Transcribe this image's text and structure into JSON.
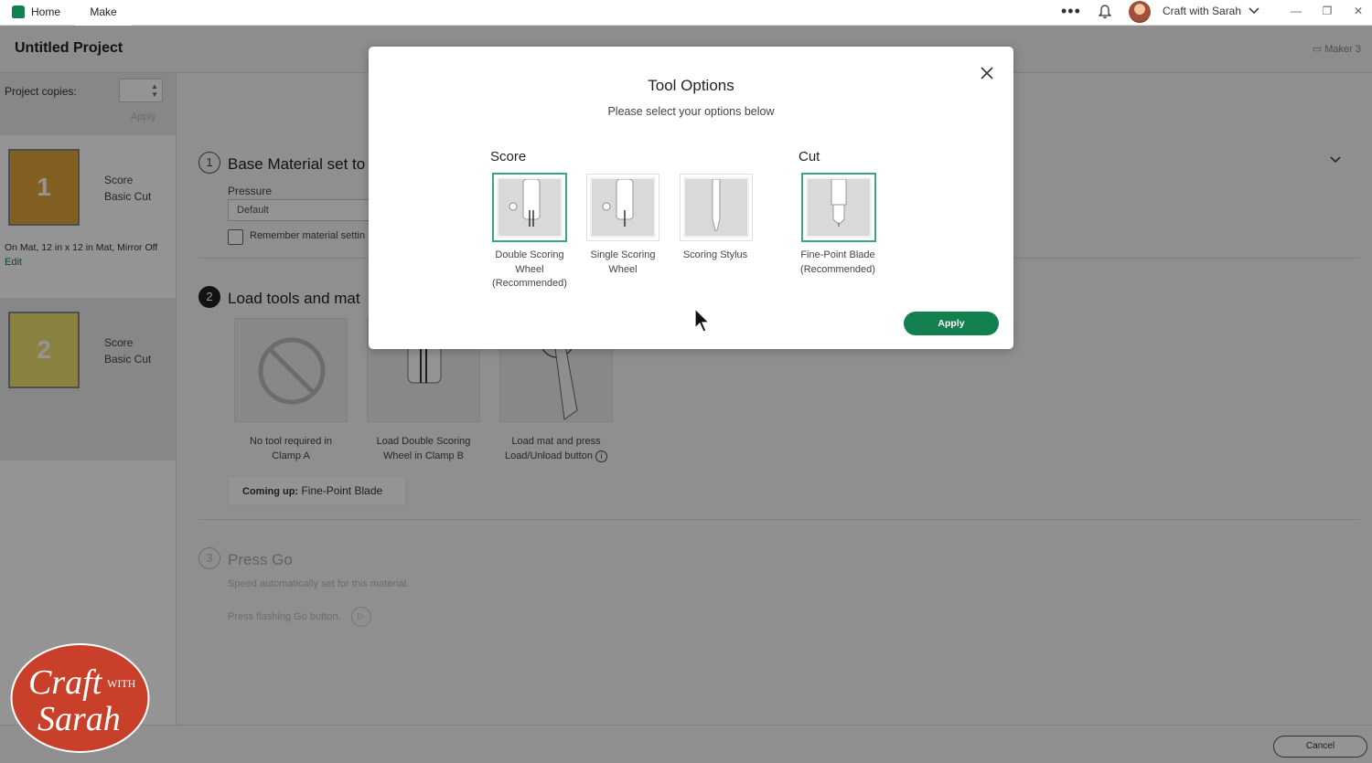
{
  "titlebar": {
    "tabs": [
      "Home",
      "Make"
    ],
    "user_name": "Craft with Sarah",
    "more_icon": "ellipsis-icon",
    "bell_icon": "bell-icon"
  },
  "header": {
    "project_title": "Untitled Project",
    "machine": "Maker 3"
  },
  "sidebar": {
    "copies_label": "Project copies:",
    "copies_apply": "Apply",
    "mats": [
      {
        "number": "1",
        "line1": "Score",
        "line2": "Basic Cut",
        "info": "On Mat, 12 in x 12 in Mat, Mirror Off",
        "edit": "Edit",
        "color": "#e2a43a"
      },
      {
        "number": "2",
        "line1": "Score",
        "line2": "Basic Cut",
        "color": "#ece070"
      }
    ]
  },
  "steps": {
    "step1": {
      "number": "1",
      "title": "Base Material set to",
      "pressure_label": "Pressure",
      "pressure_value": "Default",
      "remember_label": "Remember material settin"
    },
    "step2": {
      "number": "2",
      "title": "Load tools and mat",
      "tools": [
        {
          "line1": "No tool required in",
          "line2": "Clamp A"
        },
        {
          "line1": "Load Double Scoring",
          "line2": "Wheel in Clamp B"
        },
        {
          "line1": "Load mat and press",
          "line2": "Load/Unload button"
        }
      ],
      "coming_up_label": "Coming up:",
      "coming_up_value": "Fine-Point Blade"
    },
    "step3": {
      "number": "3",
      "title": "Press Go",
      "speed_text": "Speed automatically set for this material.",
      "press_text": "Press flashing Go button."
    }
  },
  "footer": {
    "cancel": "Cancel"
  },
  "modal": {
    "title": "Tool Options",
    "subtitle": "Please select your options below",
    "score_heading": "Score",
    "cut_heading": "Cut",
    "score_options": [
      {
        "line1": "Double Scoring",
        "line2": "Wheel",
        "line3": "(Recommended)",
        "selected": true
      },
      {
        "line1": "Single Scoring",
        "line2": "Wheel",
        "line3": "",
        "selected": false
      },
      {
        "line1": "Scoring Stylus",
        "line2": "",
        "line3": "",
        "selected": false
      }
    ],
    "cut_options": [
      {
        "line1": "Fine-Point Blade",
        "line2": "(Recommended)",
        "selected": true
      }
    ],
    "apply": "Apply",
    "accent_color": "#13804f"
  },
  "watermark": {
    "text1": "Craft",
    "text2": "WITH",
    "text3": "Sarah"
  }
}
